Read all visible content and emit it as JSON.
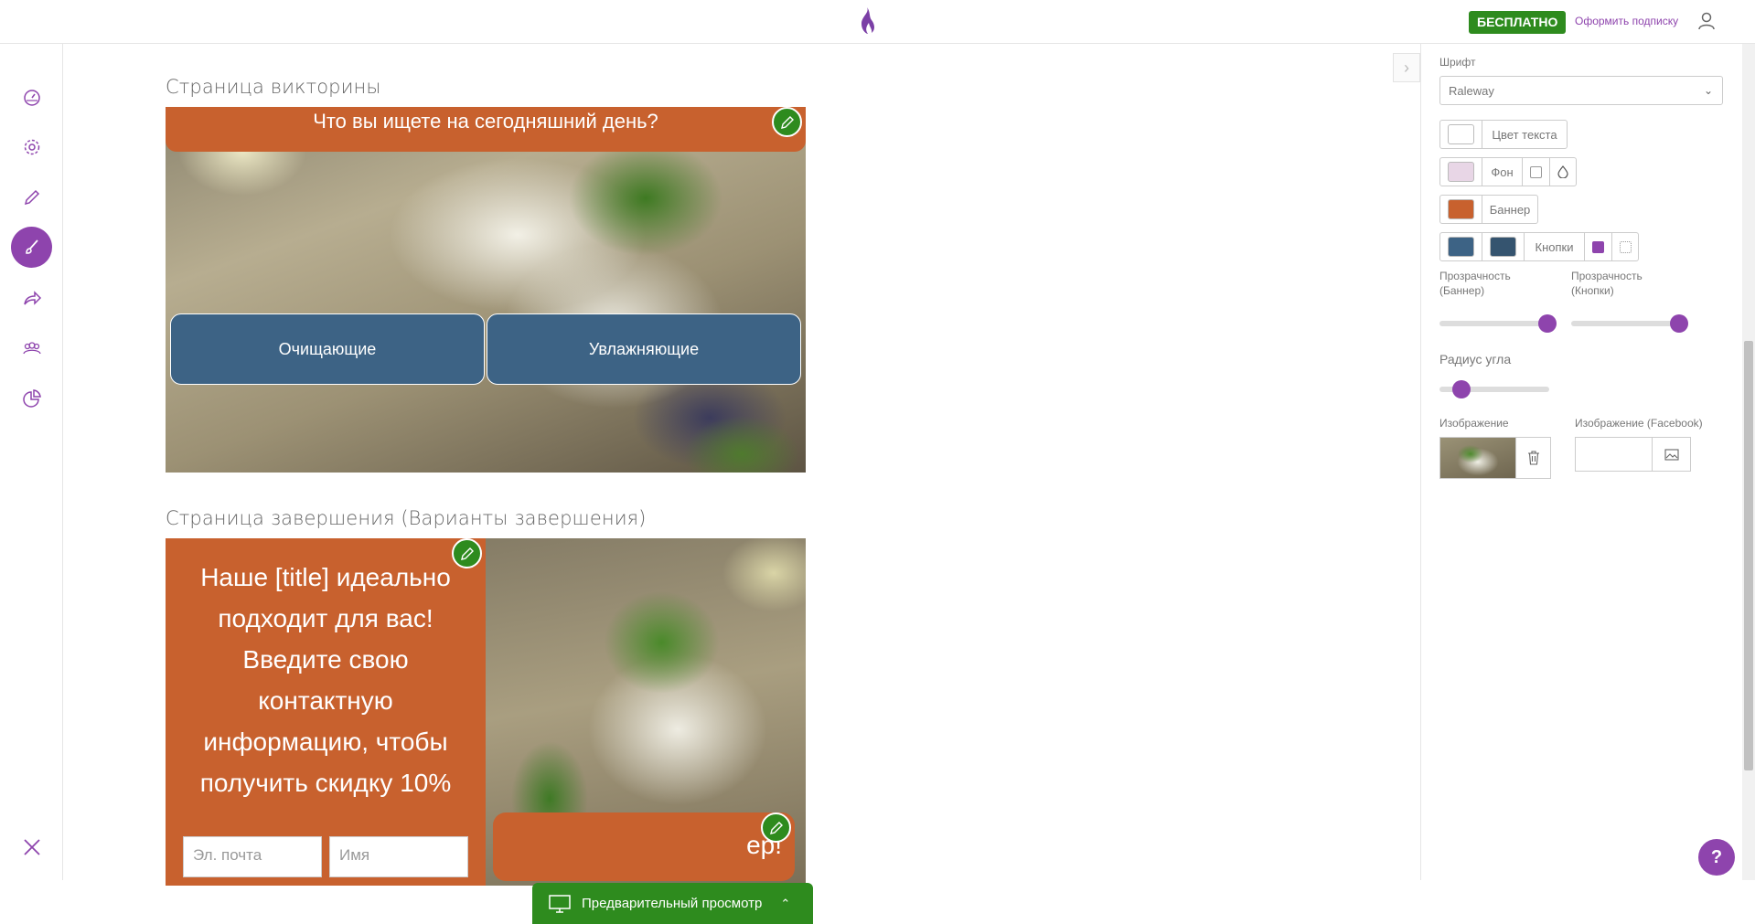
{
  "header": {
    "logo": "logo-flame-icon",
    "badge": "БЕСПЛАТНО",
    "subscribe": "Оформить подписку",
    "user_icon": "user-icon"
  },
  "sidebar": {
    "items": [
      {
        "icon": "dashboard-icon",
        "active": false
      },
      {
        "icon": "gear-icon",
        "active": false
      },
      {
        "icon": "pencil-icon",
        "active": false
      },
      {
        "icon": "brush-icon",
        "active": true
      },
      {
        "icon": "share-icon",
        "active": false
      },
      {
        "icon": "users-icon",
        "active": false
      },
      {
        "icon": "pie-chart-icon",
        "active": false
      }
    ],
    "close_icon": "close-icon"
  },
  "main": {
    "quiz_section_title": "Страница викторины",
    "quiz_question": "Что вы ищете на сегодняшний день?",
    "answers": [
      "Очищающие",
      "Увлажняющие"
    ],
    "end_section_title": "Страница завершения (Варианты завершения)",
    "end_text": "Наше [title] идеально подходит для вас! Введите свою контактную информацию, чтобы получить скидку 10%",
    "email_placeholder": "Эл. почта",
    "name_placeholder": "Имя",
    "end_banner_fragment": "ер!",
    "preview_label": "Предварительный просмотр"
  },
  "panel": {
    "font_label": "Шрифт",
    "font_value": "Raleway",
    "text_color_label": "Цвет текста",
    "background_label": "Фон",
    "banner_label": "Баннер",
    "buttons_label": "Кнопки",
    "banner_opacity_label": "Прозрачность (Баннер)",
    "buttons_opacity_label": "Прозрачность (Кнопки)",
    "corner_radius_label": "Радиус угла",
    "image_label": "Изображение",
    "fb_image_label": "Изображение (Facebook)",
    "banner_opacity": 0.98,
    "buttons_opacity": 0.98,
    "corner_radius": 0.2
  },
  "colors": {
    "accent": "#8e44ad",
    "green": "#2e8b1e",
    "banner": "#c8612e",
    "button": "#3d6385",
    "button2": "#35546f",
    "text_color": "#ffffff",
    "background": "#e8d6e6"
  }
}
